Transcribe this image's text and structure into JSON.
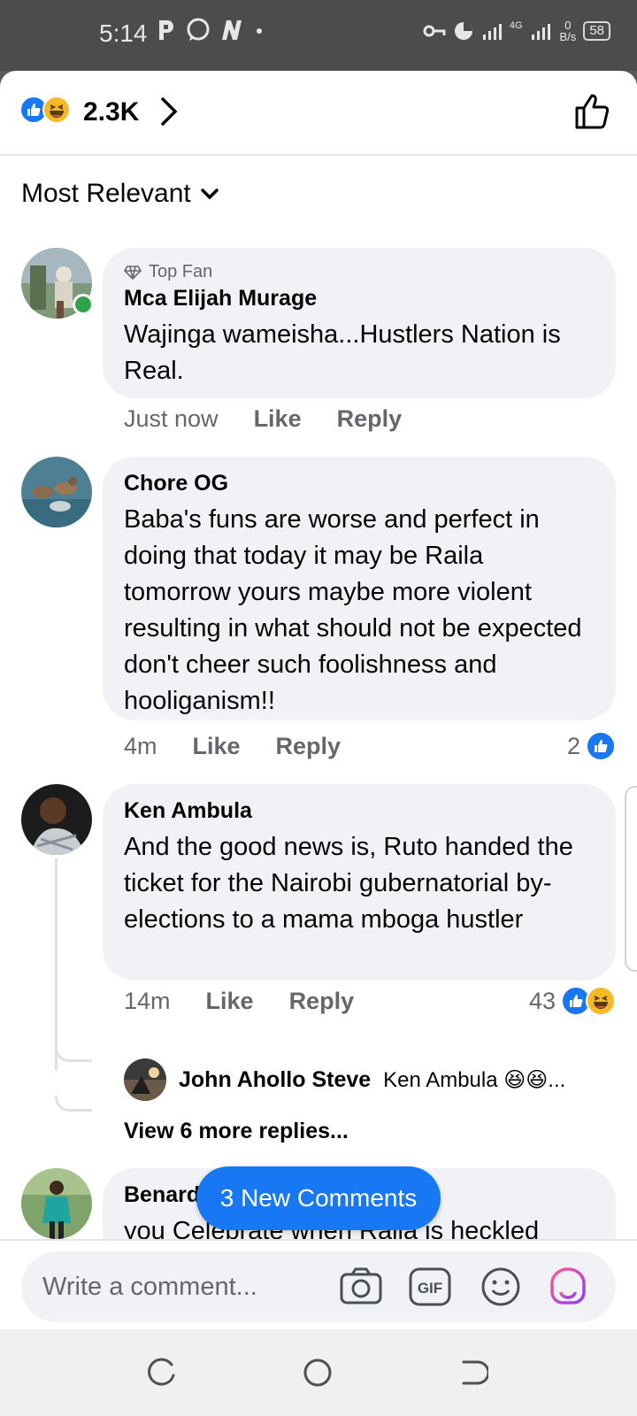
{
  "status_bar": {
    "time": "5:14",
    "network": "4G",
    "speed_value": "0",
    "speed_unit": "B/s",
    "battery": "58"
  },
  "reactions": {
    "count": "2.3K",
    "types": [
      "like",
      "haha"
    ]
  },
  "sort": {
    "label": "Most Relevant"
  },
  "comments": [
    {
      "badge": "Top Fan",
      "author": "Mca Elijah Murage",
      "text": "Wajinga wameisha...Hustlers Nation is Real.",
      "time": "Just now",
      "like_label": "Like",
      "reply_label": "Reply",
      "online": true
    },
    {
      "author": "Chore OG",
      "text": "Baba's funs are worse and perfect in doing that today it may be Raila tomorrow yours maybe more violent resulting in what should not be expected don't cheer such foolishness and hooliganism!!",
      "time": "4m",
      "like_label": "Like",
      "reply_label": "Reply",
      "reaction_count": "2"
    },
    {
      "author": "Ken Ambula",
      "text": "And the good news is, Ruto handed the ticket for the Nairobi gubernatorial by-elections to a mama mboga hustler",
      "time": "14m",
      "like_label": "Like",
      "reply_label": "Reply",
      "reaction_count": "43",
      "reply_preview": {
        "author": "John Ahollo Steve",
        "text": "Ken Ambula 😆😆..."
      },
      "view_more": "View 6 more replies..."
    },
    {
      "author": "Benard",
      "text": "you Celebrate when Raila is heckled"
    }
  ],
  "new_comments_button": "3 New Comments",
  "composer": {
    "placeholder": "Write a comment..."
  },
  "colors": {
    "accent": "#1877f2",
    "bubble": "#f0f2f5",
    "secondary_text": "#65676b",
    "online": "#31a24c"
  }
}
